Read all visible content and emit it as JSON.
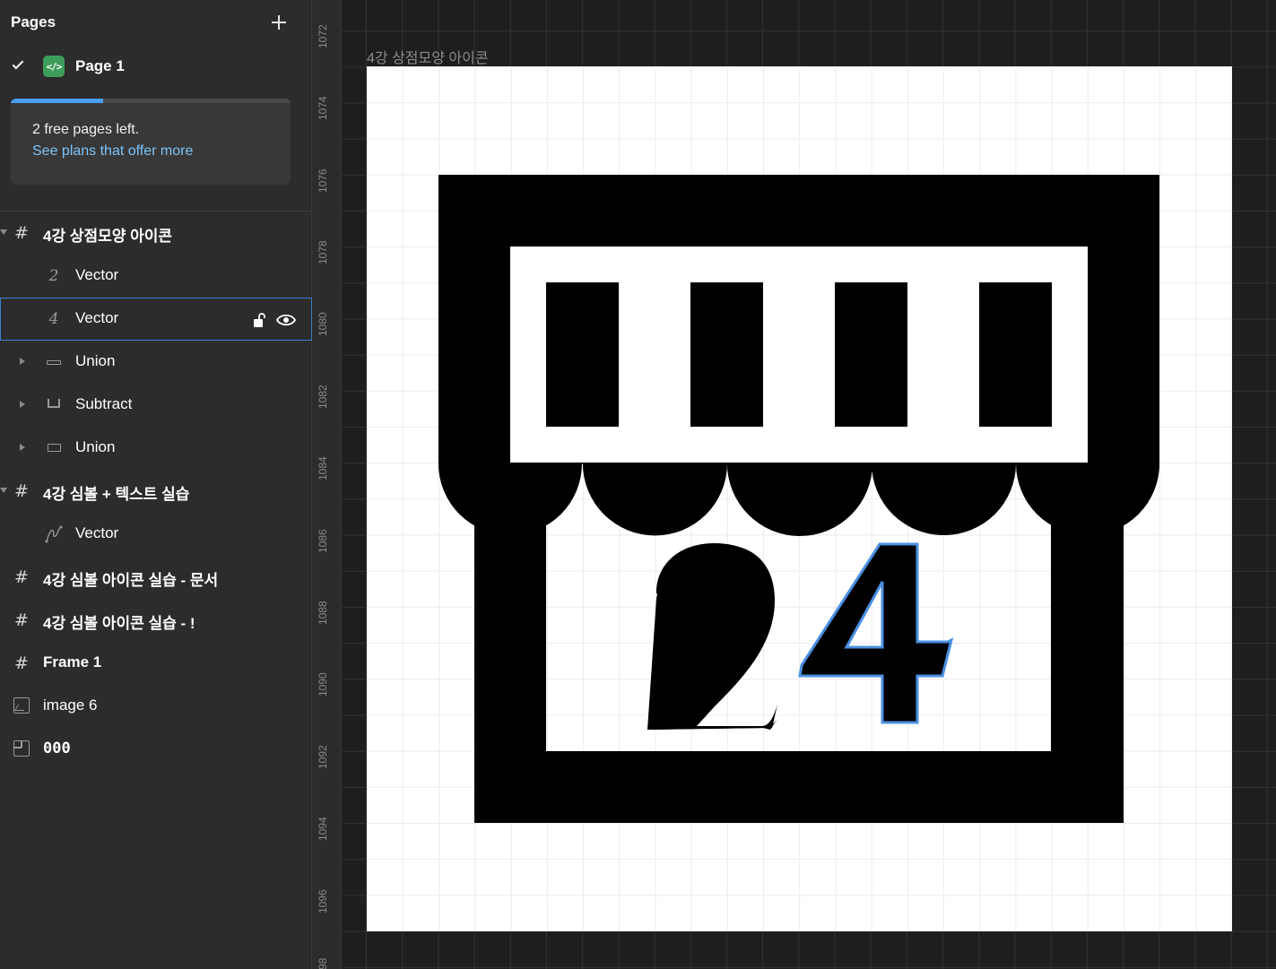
{
  "sidebar": {
    "pages_title": "Pages",
    "current_page": "Page 1",
    "promo": {
      "text": "2 free pages left.",
      "link": "See plans that offer more",
      "progress": 0.33
    },
    "layers": [
      {
        "label": "4강 상점모양 아이콘",
        "type": "frame",
        "expanded": true
      },
      {
        "label": "Vector",
        "type": "vector-2"
      },
      {
        "label": "Vector",
        "type": "vector-4",
        "selected": true
      },
      {
        "label": "Union",
        "type": "union",
        "collapsed": true
      },
      {
        "label": "Subtract",
        "type": "subtract",
        "collapsed": true
      },
      {
        "label": "Union",
        "type": "union",
        "collapsed": true
      },
      {
        "label": "4강 심볼 + 텍스트 실습",
        "type": "frame",
        "expanded": true
      },
      {
        "label": "Vector",
        "type": "vector-pen"
      },
      {
        "label": "4강 심볼 아이콘 실습 - 문서",
        "type": "frame"
      },
      {
        "label": "4강 심볼 아이콘 실습 - !",
        "type": "frame"
      },
      {
        "label": "Frame 1",
        "type": "frame"
      },
      {
        "label": "image 6",
        "type": "image"
      },
      {
        "label": "000",
        "type": "section"
      }
    ]
  },
  "ruler": {
    "labels": [
      "1072",
      "1074",
      "1076",
      "1078",
      "1080",
      "1082",
      "1084",
      "1086",
      "1088",
      "1090",
      "1092",
      "1094",
      "1096",
      "98"
    ]
  },
  "canvas": {
    "frame_title": "4강 상점모양 아이콘",
    "store_number": "24",
    "digit_one": "2",
    "digit_two": "4"
  },
  "colors": {
    "accent": "#3d7fd0",
    "selection_outline": "#4a90e2",
    "page_icon": "#3e9d5a",
    "link": "#7cc4fa"
  },
  "icons": [
    "plus-icon",
    "check-icon",
    "code-icon",
    "frame-icon",
    "vector-icon",
    "union-icon",
    "subtract-icon",
    "image-icon",
    "section-icon",
    "lock-icon",
    "eye-icon"
  ]
}
